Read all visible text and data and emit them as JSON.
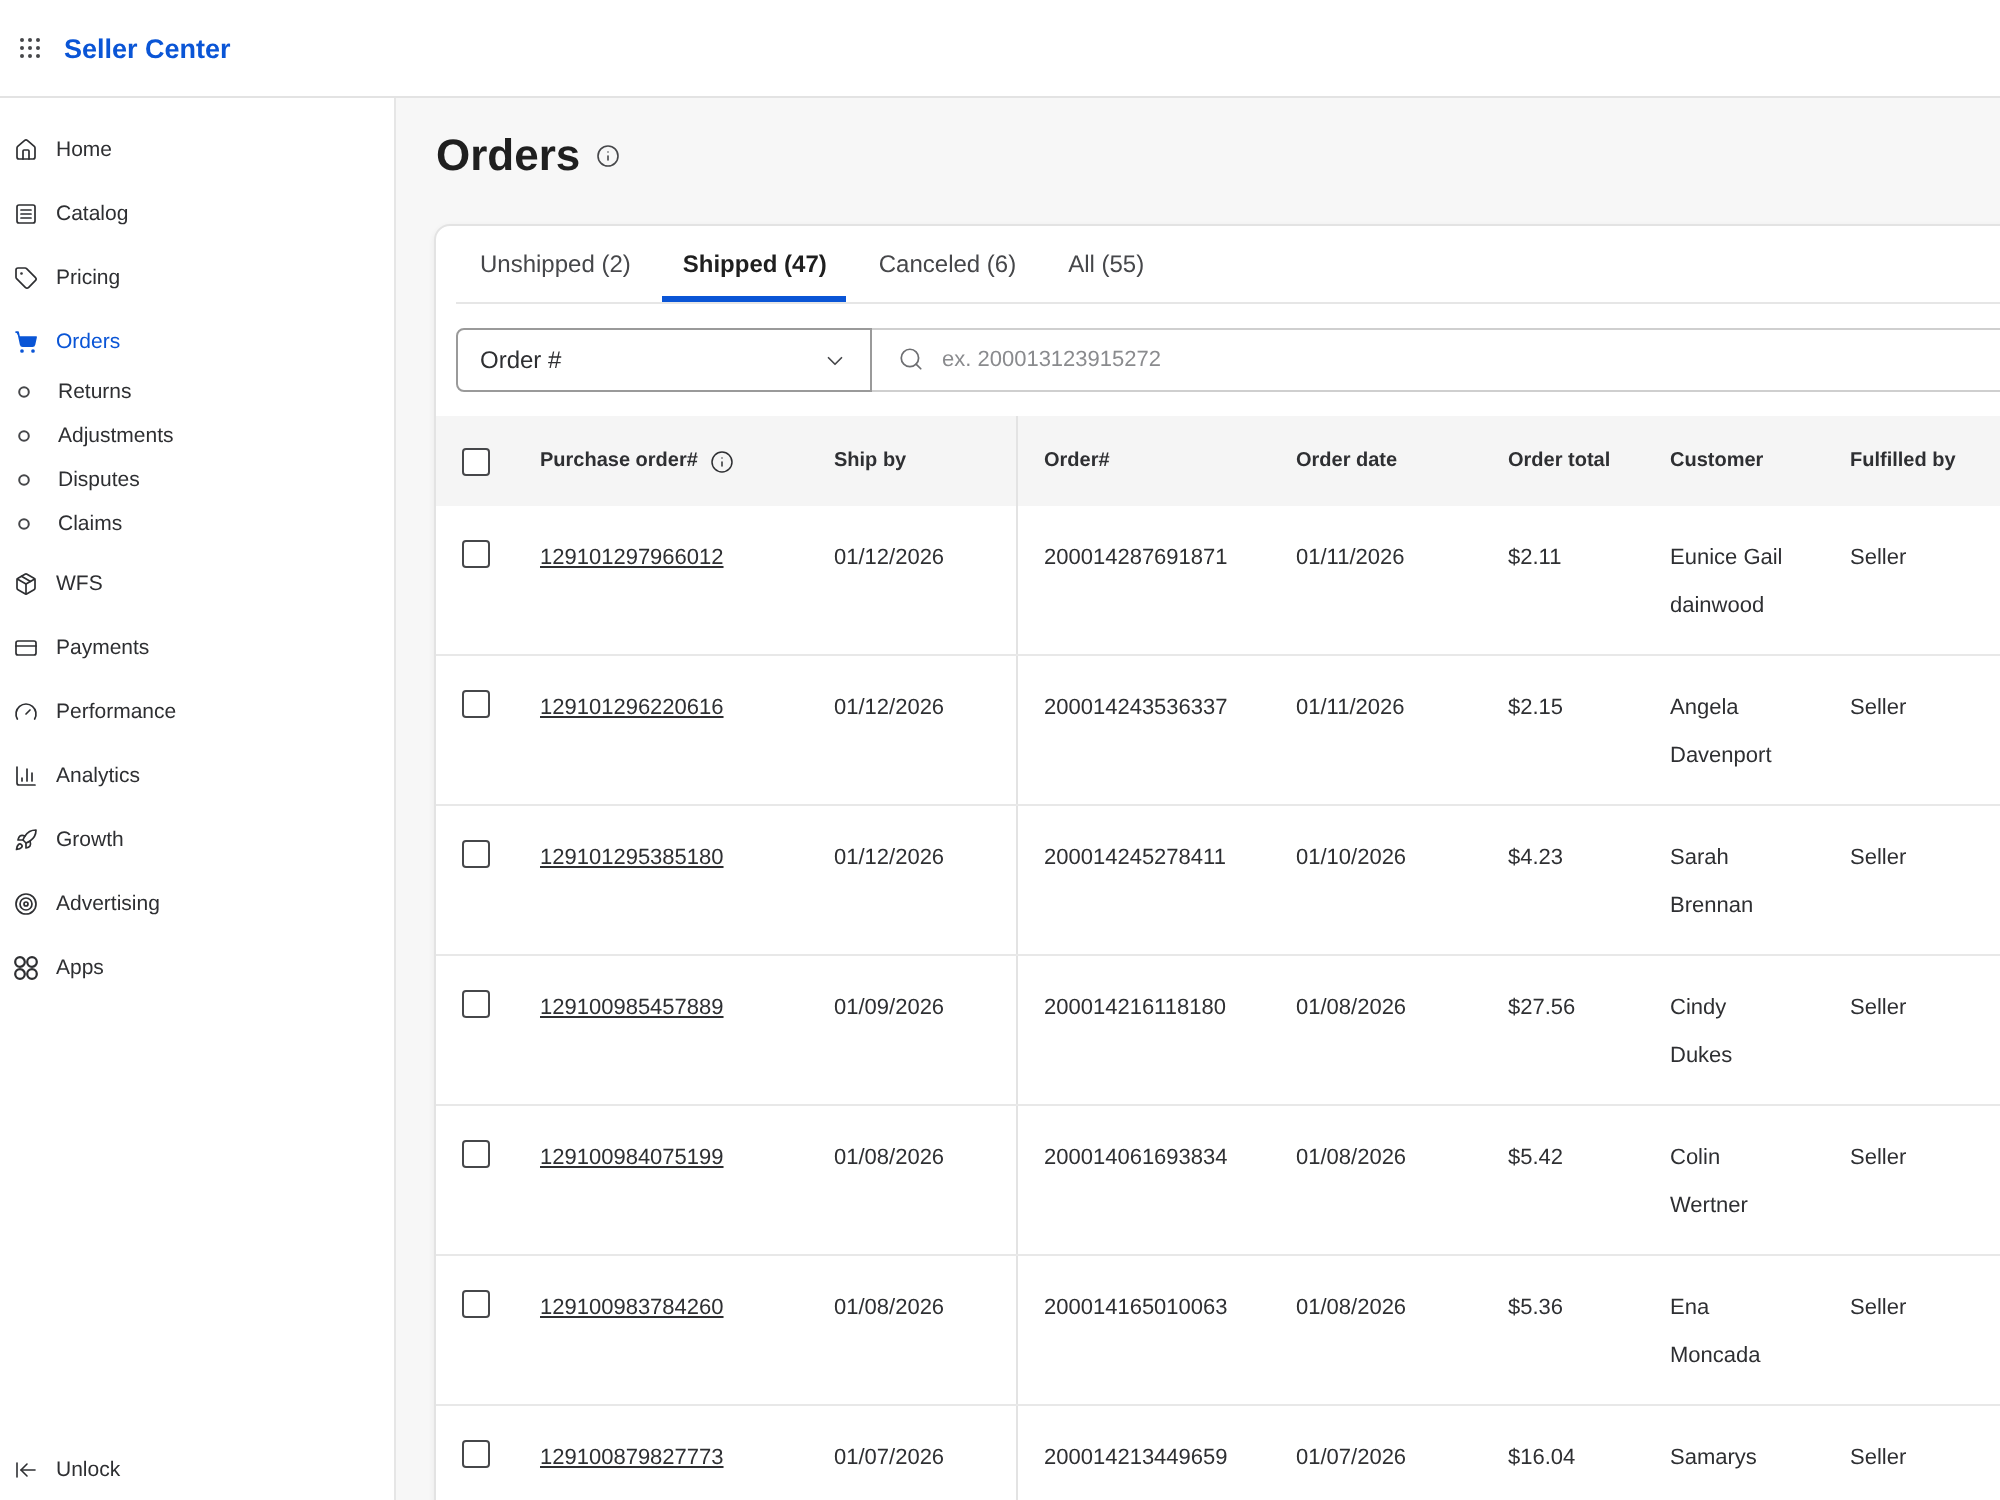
{
  "top_bar": {
    "title": "Seller Center"
  },
  "sidebar": {
    "items": [
      {
        "label": "Home",
        "selected": false
      },
      {
        "label": "Catalog",
        "selected": false
      },
      {
        "label": "Pricing",
        "selected": false
      },
      {
        "label": "Orders",
        "selected": true,
        "children": [
          {
            "label": "Returns",
            "selected": false
          },
          {
            "label": "Adjustments",
            "selected": false
          },
          {
            "label": "Disputes",
            "selected": false
          },
          {
            "label": "Claims",
            "selected": false
          }
        ]
      },
      {
        "label": "WFS",
        "selected": false
      },
      {
        "label": "Payments",
        "selected": false
      },
      {
        "label": "Performance",
        "selected": false
      },
      {
        "label": "Analytics",
        "selected": false
      },
      {
        "label": "Growth",
        "selected": false
      },
      {
        "label": "Advertising",
        "selected": false
      },
      {
        "label": "Apps",
        "selected": false
      }
    ],
    "footer": {
      "label": "Unlock"
    }
  },
  "page": {
    "title": "Orders"
  },
  "tabs": [
    {
      "label": "Unshipped (2)",
      "selected": false
    },
    {
      "label": "Shipped (47)",
      "selected": true
    },
    {
      "label": "Canceled (6)",
      "selected": false
    },
    {
      "label": "All (55)",
      "selected": false
    }
  ],
  "filter": {
    "field": "Order #",
    "placeholder": "ex. 200013123915272"
  },
  "table": {
    "select_all": {
      "checked": false
    },
    "columns": [
      "Purchase order#",
      "Ship by",
      "Order#",
      "Order date",
      "Order total",
      "Customer",
      "Fulfilled by"
    ],
    "rows": [
      {
        "checked": false,
        "purchase_order": "129101297966012",
        "ship_by": "01/12/2026",
        "order": "200014287691871",
        "order_date": "01/11/2026",
        "order_total": "$2.11",
        "customer": "Eunice Gail dainwood",
        "fulfilled_by": "Seller"
      },
      {
        "checked": false,
        "purchase_order": "129101296220616",
        "ship_by": "01/12/2026",
        "order": "200014243536337",
        "order_date": "01/11/2026",
        "order_total": "$2.15",
        "customer": "Angela Davenport",
        "fulfilled_by": "Seller"
      },
      {
        "checked": false,
        "purchase_order": "129101295385180",
        "ship_by": "01/12/2026",
        "order": "200014245278411",
        "order_date": "01/10/2026",
        "order_total": "$4.23",
        "customer": "Sarah Brennan",
        "fulfilled_by": "Seller"
      },
      {
        "checked": false,
        "purchase_order": "129100985457889",
        "ship_by": "01/09/2026",
        "order": "200014216118180",
        "order_date": "01/08/2026",
        "order_total": "$27.56",
        "customer": "Cindy Dukes",
        "fulfilled_by": "Seller"
      },
      {
        "checked": false,
        "purchase_order": "129100984075199",
        "ship_by": "01/08/2026",
        "order": "200014061693834",
        "order_date": "01/08/2026",
        "order_total": "$5.42",
        "customer": "Colin Wertner",
        "fulfilled_by": "Seller"
      },
      {
        "checked": false,
        "purchase_order": "129100983784260",
        "ship_by": "01/08/2026",
        "order": "200014165010063",
        "order_date": "01/08/2026",
        "order_total": "$5.36",
        "customer": "Ena Moncada",
        "fulfilled_by": "Seller"
      },
      {
        "checked": false,
        "purchase_order": "129100879827773",
        "ship_by": "01/07/2026",
        "order": "200014213449659",
        "order_date": "01/07/2026",
        "order_total": "$16.04",
        "customer": "Samarys",
        "fulfilled_by": "Seller"
      }
    ]
  }
}
